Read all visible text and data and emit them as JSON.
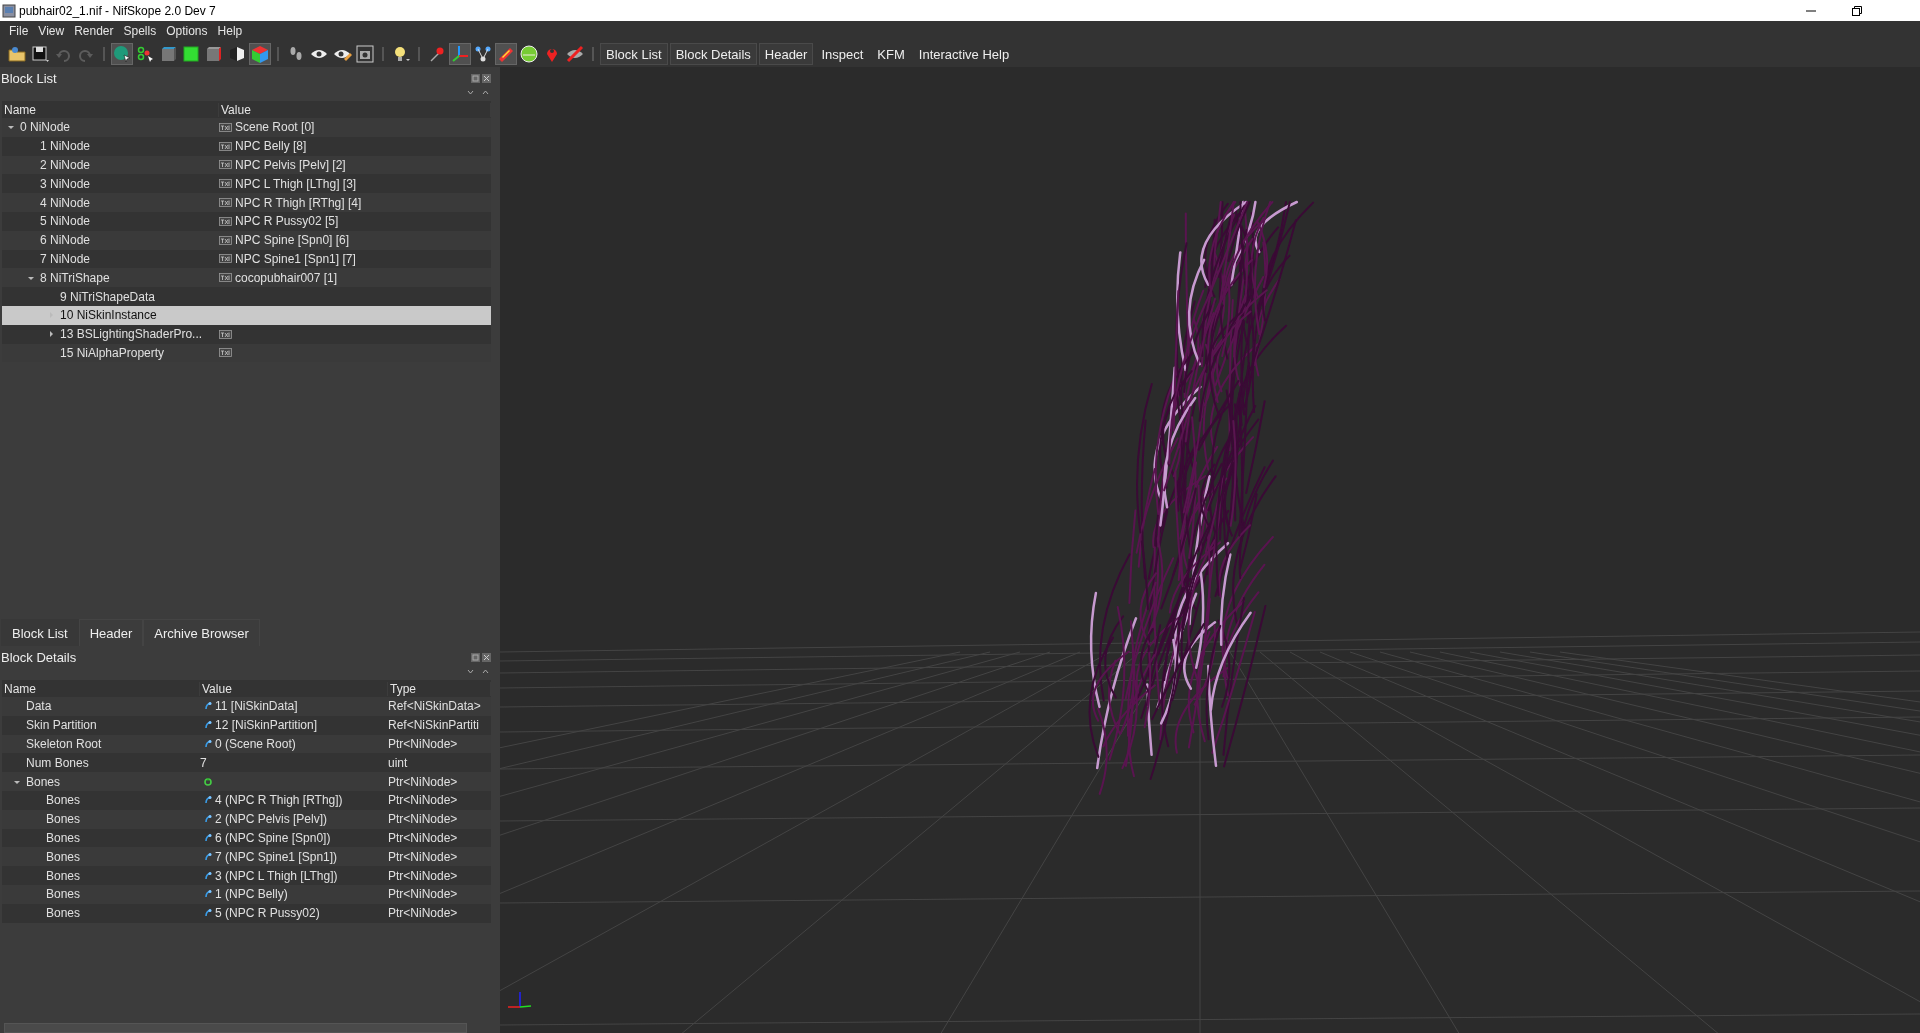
{
  "window": {
    "title": "pubhair02_1.nif - NifSkope 2.0 Dev 7"
  },
  "menu": [
    "File",
    "View",
    "Render",
    "Spells",
    "Options",
    "Help"
  ],
  "toolbar": {
    "icon_groups": [
      [
        {
          "checked": false,
          "disabled": false
        },
        {
          "checked": false,
          "disabled": false
        },
        {
          "checked": false,
          "disabled": true
        },
        {
          "checked": false,
          "disabled": true
        }
      ],
      [
        {
          "checked": true,
          "disabled": false
        },
        {
          "checked": false,
          "disabled": false
        },
        {
          "checked": false,
          "disabled": false
        },
        {
          "checked": false,
          "disabled": false
        },
        {
          "checked": false,
          "disabled": false
        },
        {
          "checked": false,
          "disabled": false
        },
        {
          "checked": true,
          "disabled": false
        }
      ],
      [
        {
          "checked": false,
          "disabled": false
        },
        {
          "checked": false,
          "disabled": false
        },
        {
          "checked": false,
          "disabled": false
        },
        {
          "checked": false,
          "disabled": false
        }
      ],
      [
        {
          "checked": false,
          "disabled": false
        }
      ],
      [
        {
          "checked": false,
          "disabled": false
        },
        {
          "checked": true,
          "disabled": false
        },
        {
          "checked": false,
          "disabled": false
        },
        {
          "checked": true,
          "disabled": false
        },
        {
          "checked": false,
          "disabled": false
        },
        {
          "checked": false,
          "disabled": false
        },
        {
          "checked": false,
          "disabled": false
        }
      ]
    ],
    "panel_buttons": [
      {
        "label": "Block List",
        "checked": true
      },
      {
        "label": "Block Details",
        "checked": true
      },
      {
        "label": "Header",
        "checked": true
      },
      {
        "label": "Inspect",
        "checked": false
      },
      {
        "label": "KFM",
        "checked": false
      },
      {
        "label": "Interactive Help",
        "checked": false
      }
    ]
  },
  "block_list": {
    "title": "Block List",
    "columns": [
      "Name",
      "Value"
    ],
    "rows": [
      {
        "name": "0 NiNode",
        "value": "Scene Root [0]",
        "value_icon": true,
        "selected": false,
        "expanded": true,
        "children": [
          {
            "name": "1 NiNode",
            "value": "NPC Belly [8]",
            "value_icon": true,
            "selected": false
          },
          {
            "name": "2 NiNode",
            "value": "NPC Pelvis [Pelv] [2]",
            "value_icon": true,
            "selected": false
          },
          {
            "name": "3 NiNode",
            "value": "NPC L Thigh [LThg] [3]",
            "value_icon": true,
            "selected": false
          },
          {
            "name": "4 NiNode",
            "value": "NPC R Thigh [RThg] [4]",
            "value_icon": true,
            "selected": false
          },
          {
            "name": "5 NiNode",
            "value": "NPC R Pussy02 [5]",
            "value_icon": true,
            "selected": false
          },
          {
            "name": "6 NiNode",
            "value": "NPC Spine [Spn0] [6]",
            "value_icon": true,
            "selected": false
          },
          {
            "name": "7 NiNode",
            "value": "NPC Spine1 [Spn1] [7]",
            "value_icon": true,
            "selected": false
          },
          {
            "name": "8 NiTriShape",
            "value": "cocopubhair007 [1]",
            "value_icon": true,
            "selected": false,
            "expanded": true,
            "children": [
              {
                "name": "9 NiTriShapeData",
                "value_icon": false,
                "selected": false
              },
              {
                "name": "10 NiSkinInstance",
                "value_icon": false,
                "selected": true,
                "expanded": false
              },
              {
                "name": "13 BSLightingShaderPro...",
                "value_icon": true,
                "selected": false,
                "expanded": false
              },
              {
                "name": "15 NiAlphaProperty",
                "value_icon": true,
                "selected": false
              }
            ]
          }
        ]
      }
    ]
  },
  "dock_tabs": [
    {
      "label": "Block List",
      "selected": true
    },
    {
      "label": "Header",
      "selected": false
    },
    {
      "label": "Archive Browser",
      "selected": false
    }
  ],
  "block_details": {
    "title": "Block Details",
    "columns": [
      "Name",
      "Value",
      "Type"
    ],
    "rows": [
      {
        "name": "Data",
        "value": "11 [NiSkinData]",
        "kind": "ref",
        "type": "Ref<NiSkinData>"
      },
      {
        "name": "Skin Partition",
        "value": "12 [NiSkinPartition]",
        "kind": "ref",
        "type": "Ref<NiSkinPartiti"
      },
      {
        "name": "Skeleton Root",
        "value": "0 (Scene Root)",
        "kind": "ref",
        "type": "Ptr<NiNode>"
      },
      {
        "name": "Num Bones",
        "value": "7",
        "kind": "plain",
        "type": "uint"
      },
      {
        "name": "Bones",
        "kind": "array",
        "type": "Ptr<NiNode>",
        "expanded": true,
        "children": [
          {
            "name": "Bones",
            "value": "4 (NPC R Thigh [RThg])",
            "kind": "ref",
            "type": "Ptr<NiNode>"
          },
          {
            "name": "Bones",
            "value": "2 (NPC Pelvis [Pelv])",
            "kind": "ref",
            "type": "Ptr<NiNode>"
          },
          {
            "name": "Bones",
            "value": "6 (NPC Spine [Spn0])",
            "kind": "ref",
            "type": "Ptr<NiNode>"
          },
          {
            "name": "Bones",
            "value": "7 (NPC Spine1 [Spn1])",
            "kind": "ref",
            "type": "Ptr<NiNode>"
          },
          {
            "name": "Bones",
            "value": "3 (NPC L Thigh [LThg])",
            "kind": "ref",
            "type": "Ptr<NiNode>"
          },
          {
            "name": "Bones",
            "value": "1 (NPC Belly)",
            "kind": "ref",
            "type": "Ptr<NiNode>"
          },
          {
            "name": "Bones",
            "value": "5 (NPC R Pussy02)",
            "kind": "ref",
            "type": "Ptr<NiNode>"
          }
        ]
      }
    ]
  }
}
